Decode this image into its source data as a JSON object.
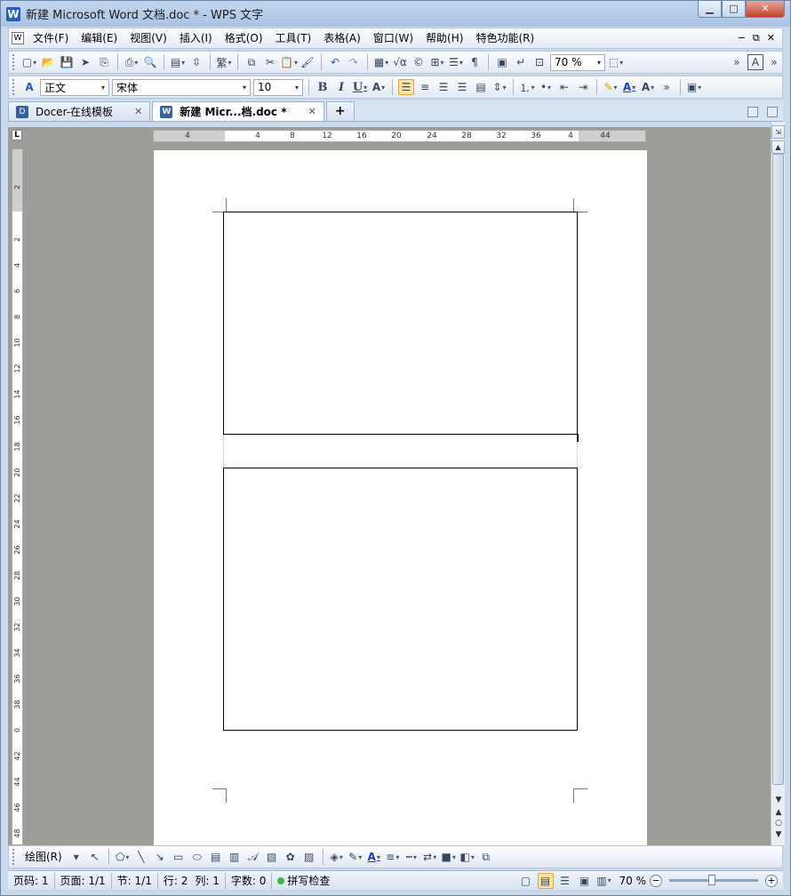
{
  "window": {
    "app_icon": "W",
    "title": "新建 Microsoft Word 文档.doc * - WPS 文字",
    "min_glyph": "▁",
    "max_glyph": "□",
    "close_glyph": "✕"
  },
  "menubar": {
    "items": [
      "文件(F)",
      "编辑(E)",
      "视图(V)",
      "插入(I)",
      "格式(O)",
      "工具(T)",
      "表格(A)",
      "窗口(W)",
      "帮助(H)",
      "特色功能(R)"
    ],
    "right_controls": [
      "−",
      "⧉",
      "✕"
    ]
  },
  "toolbar_standard": {
    "zoom_value": "70 %"
  },
  "toolbar_format": {
    "style_value": "正文",
    "font_value": "宋体",
    "size_value": "10",
    "bold_label": "B",
    "italic_label": "I",
    "underline_label": "U"
  },
  "tabs": [
    {
      "icon": "D",
      "label": "Docer-在线模板",
      "close": "✕"
    },
    {
      "icon": "W",
      "label": "新建 Micr...档.doc *",
      "close": "✕"
    }
  ],
  "tab_add": "+",
  "ruler": {
    "corner": "L",
    "h_numbers": [
      "4",
      "4",
      "8",
      "12",
      "16",
      "20",
      "24",
      "28",
      "32",
      "36",
      "4",
      "44"
    ],
    "v_numbers": [
      "2",
      "2",
      "4",
      "6",
      "8",
      "10",
      "12",
      "14",
      "16",
      "18",
      "20",
      "22",
      "24",
      "26",
      "28",
      "30",
      "32",
      "34",
      "36",
      "38",
      "0",
      "42",
      "44",
      "46",
      "48"
    ]
  },
  "drawing_toolbar": {
    "draw_label": "绘图(R)"
  },
  "statusbar": {
    "page": "页码: 1",
    "pages": "页面: 1/1",
    "section": "节: 1/1",
    "row": "行: 2",
    "col": "列: 1",
    "words": "字数: 0",
    "spellcheck": "拼写检查",
    "zoom": "70 %"
  },
  "colors": {
    "accent": "#2b5cb8",
    "doc_background": "#9c9c98",
    "page": "#ffffff"
  }
}
